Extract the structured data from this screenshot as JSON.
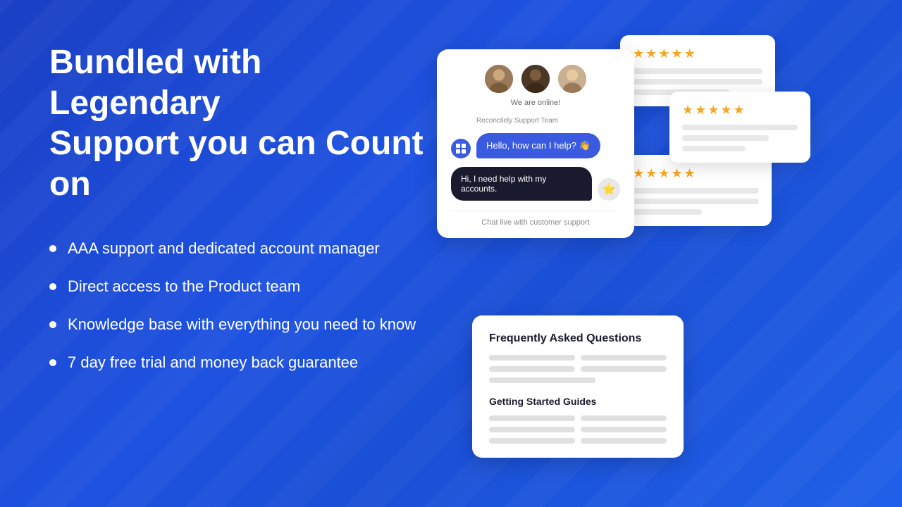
{
  "headline": {
    "line1": "Bundled with Legendary",
    "line2": "Support you can Count on"
  },
  "bullets": [
    "AAA support and dedicated account manager",
    "Direct access to the Product team",
    "Knowledge base with everything you need to know",
    "7 day free trial and money back guarantee"
  ],
  "chat": {
    "online_text": "We are online!",
    "support_label": "Reconcilely Support Team",
    "greeting": "Hello, how can I help? 👋",
    "user_message": "Hi, I need help with my accounts.",
    "footer": "Chat live with customer support"
  },
  "reviews": [
    {
      "stars": "★★★★★"
    },
    {
      "stars": "★★★★★"
    },
    {
      "stars": "★★★★★"
    }
  ],
  "faq": {
    "title": "Frequently Asked Questions",
    "guides_title": "Getting Started Guides"
  },
  "colors": {
    "blue": "#1a4fd6",
    "dark_blue": "#3a5be0",
    "black": "#1a1a2e",
    "star": "#f5a623"
  }
}
